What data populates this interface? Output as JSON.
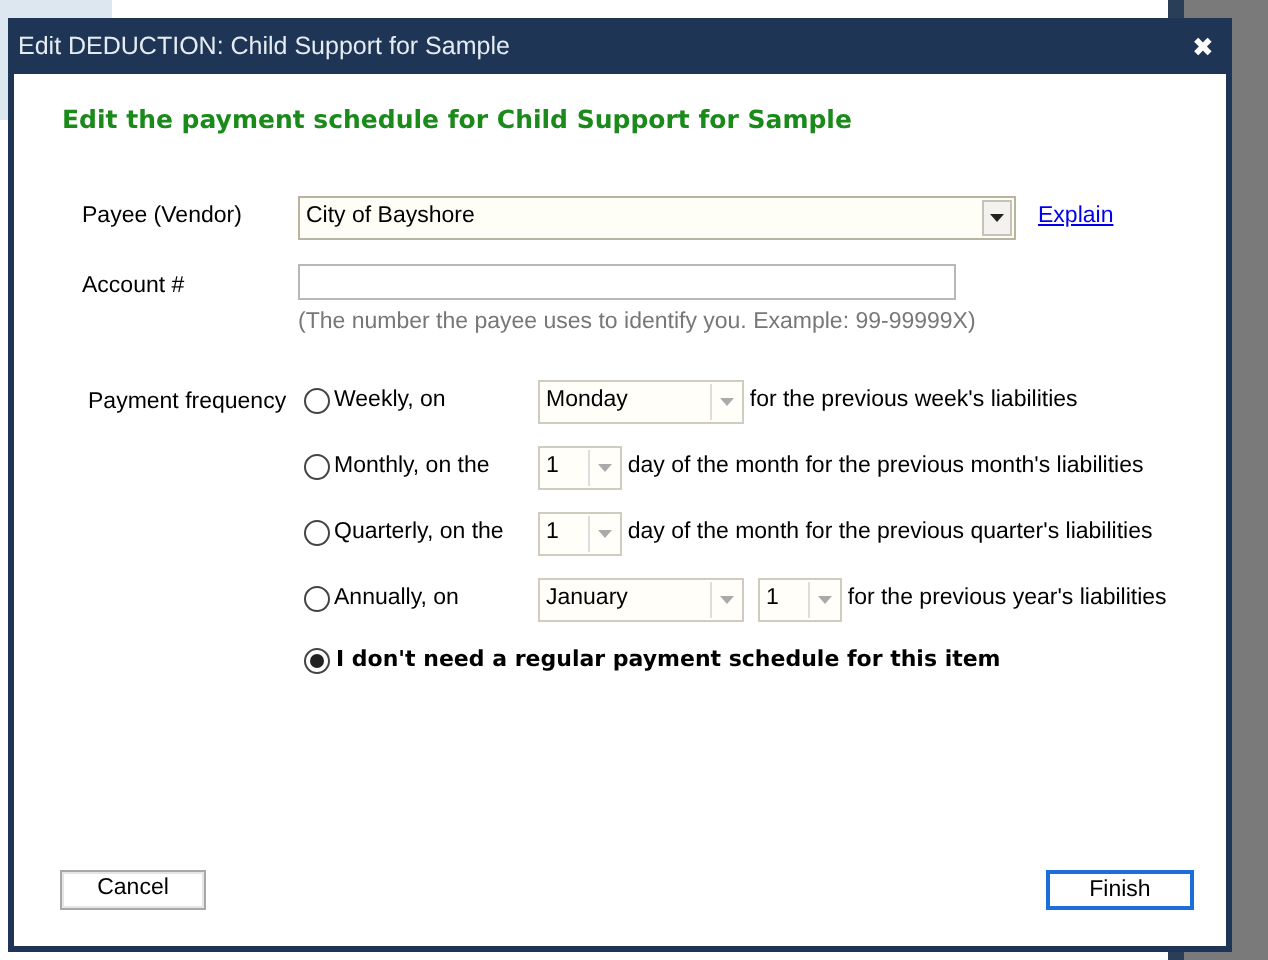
{
  "window": {
    "title": "Edit DEDUCTION: Child Support for Sample",
    "close": "✖"
  },
  "heading": "Edit the payment schedule for Child Support for Sample",
  "payee": {
    "label": "Payee (Vendor)",
    "value": "City of Bayshore",
    "link": "Explain"
  },
  "account": {
    "label": "Account #",
    "hint": "(The number the payee uses to identify you. Example: 99-99999X)"
  },
  "frequency": {
    "label": "Payment frequency",
    "options": [
      {
        "kind": "schedule",
        "label": "Weekly, on",
        "selected": false,
        "fields": [
          {
            "kind": "name",
            "value": "Monday",
            "disabled": true
          }
        ],
        "suffix": "for the previous week's liabilities"
      },
      {
        "kind": "schedule",
        "label": "Monthly, on the",
        "selected": false,
        "fields": [
          {
            "kind": "day",
            "value": "1",
            "disabled": true
          }
        ],
        "suffix": "day of the month for the previous month's liabilities"
      },
      {
        "kind": "schedule",
        "label": "Quarterly, on the",
        "selected": false,
        "fields": [
          {
            "kind": "day",
            "value": "1",
            "disabled": true
          }
        ],
        "suffix": "day of the month for the previous quarter's liabilities"
      },
      {
        "kind": "schedule",
        "label": "Annually, on",
        "selected": false,
        "fields": [
          {
            "kind": "name",
            "value": "January",
            "disabled": true
          },
          {
            "kind": "day",
            "value": "1",
            "disabled": true
          }
        ],
        "suffix": "for the previous year's liabilities"
      },
      {
        "kind": "none",
        "label": "I don't need a regular payment schedule for this item",
        "selected": true
      }
    ]
  },
  "buttons": [
    {
      "label": "Cancel",
      "default": false
    },
    {
      "label": "Finish",
      "default": true
    }
  ]
}
